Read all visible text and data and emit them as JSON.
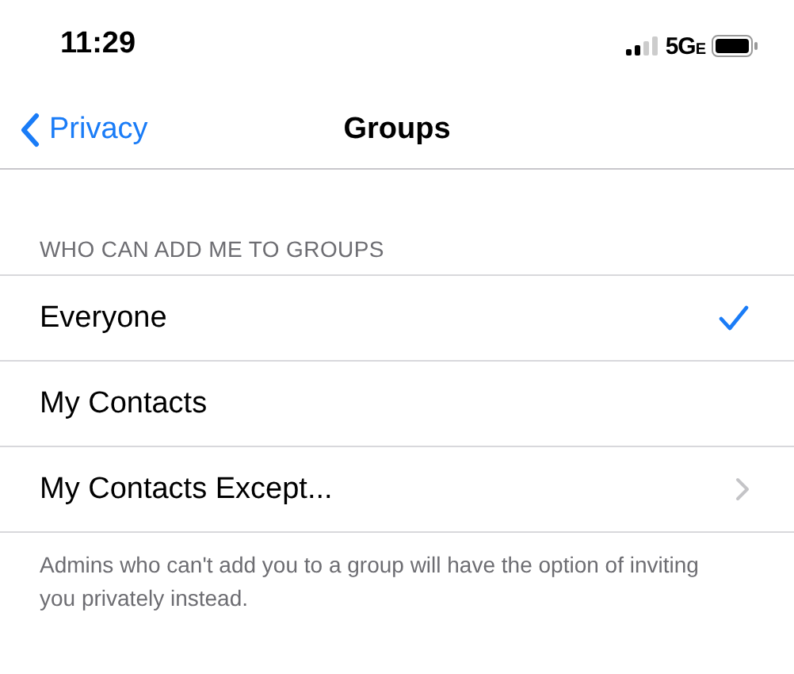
{
  "status_bar": {
    "time": "11:29",
    "network": "5G",
    "network_suffix": "E"
  },
  "nav": {
    "back": "Privacy",
    "title": "Groups"
  },
  "section": {
    "header": "WHO CAN ADD ME TO GROUPS",
    "options": [
      {
        "label": "Everyone",
        "kind": "choice",
        "selected": true
      },
      {
        "label": "My Contacts",
        "kind": "choice",
        "selected": false
      },
      {
        "label": "My Contacts Except...",
        "kind": "link",
        "selected": false
      }
    ],
    "footer": "Admins who can't add you to a group will have the option of inviting you privately instead."
  }
}
